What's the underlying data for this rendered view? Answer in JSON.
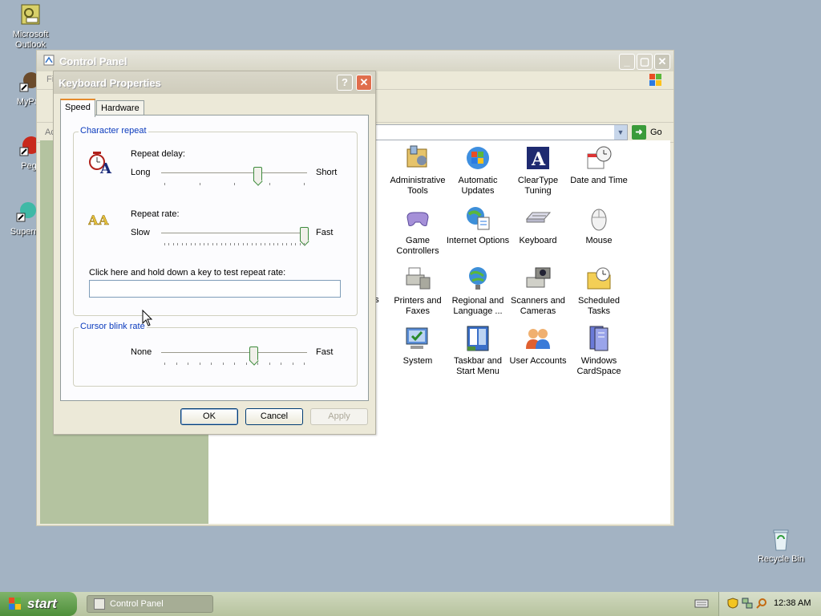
{
  "desktop": {
    "icons": [
      {
        "label": "Microsoft Outlook"
      },
      {
        "label": "MyPal"
      },
      {
        "label": "Peg"
      },
      {
        "label": "Superm"
      },
      {
        "label": "Recycle Bin"
      }
    ]
  },
  "control_panel": {
    "title": "Control Panel",
    "menu_first_letter": "Fi",
    "address_label": "Ac",
    "go_label": "Go",
    "items": [
      {
        "label": "Administrative Tools"
      },
      {
        "label": "Automatic Updates"
      },
      {
        "label": "ClearType Tuning"
      },
      {
        "label": "Date and Time"
      },
      {
        "label": "Game Controllers"
      },
      {
        "label": "Internet Options"
      },
      {
        "label": "Keyboard"
      },
      {
        "label": "Mouse"
      },
      {
        "label": "ns"
      },
      {
        "label": "Printers and Faxes"
      },
      {
        "label": "Regional and Language ..."
      },
      {
        "label": "Scanners and Cameras"
      },
      {
        "label": "Scheduled Tasks"
      },
      {
        "label": "System"
      },
      {
        "label": "Taskbar and Start Menu"
      },
      {
        "label": "User Accounts"
      },
      {
        "label": "Windows CardSpace"
      }
    ]
  },
  "dialog": {
    "title": "Keyboard Properties",
    "help_glyph": "?",
    "close_glyph": "✕",
    "tabs": [
      {
        "label": "Speed",
        "active": true
      },
      {
        "label": "Hardware",
        "active": false
      }
    ],
    "character_repeat": {
      "group_label": "Character repeat",
      "repeat_delay": {
        "label": "Repeat delay:",
        "min_label": "Long",
        "max_label": "Short",
        "value": 0.66
      },
      "repeat_rate": {
        "label": "Repeat rate:",
        "min_label": "Slow",
        "max_label": "Fast",
        "value": 0.98
      },
      "test_label": "Click here and hold down a key to test repeat rate:",
      "test_value": ""
    },
    "cursor_blink": {
      "group_label": "Cursor blink rate",
      "min_label": "None",
      "max_label": "Fast",
      "value": 0.63
    },
    "buttons": {
      "ok": "OK",
      "cancel": "Cancel",
      "apply": "Apply"
    }
  },
  "taskbar": {
    "start_label": "start",
    "task_label": "Control Panel",
    "clock": "12:38 AM"
  },
  "colors": {
    "desktop": "#a3b3c3",
    "start_green": "#4e8f3a",
    "group_label_blue": "#0b3bbd",
    "slider_thumb_border": "#3c8b3c"
  }
}
